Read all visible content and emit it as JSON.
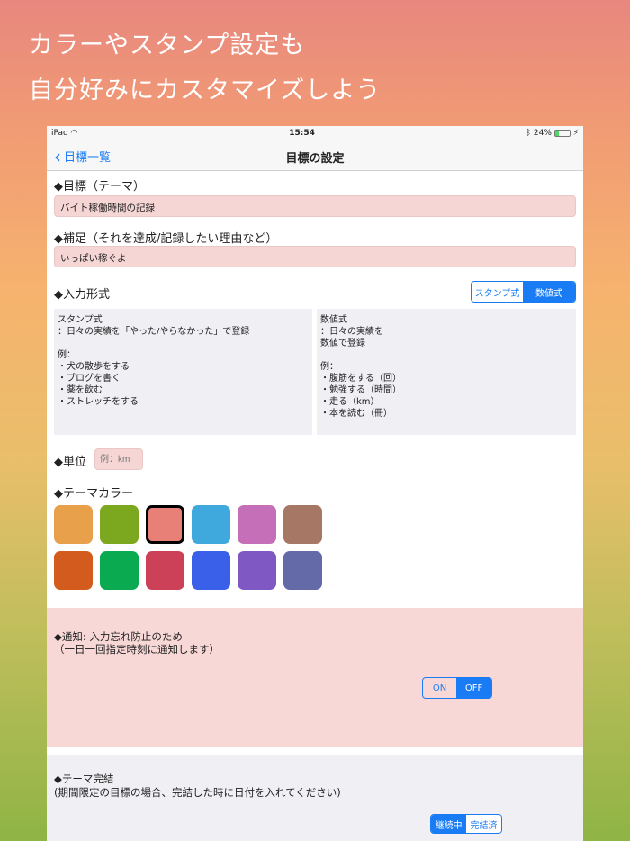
{
  "promo": {
    "line1": "カラーやスタンプ設定も",
    "line2": "自分好みにカスタマイズしよう"
  },
  "status": {
    "device": "iPad",
    "time": "15:54",
    "battery": "24%"
  },
  "nav": {
    "back": "目標一覧",
    "title": "目標の設定"
  },
  "goal": {
    "label": "◆目標（テーマ）",
    "value": "バイト稼働時間の記録"
  },
  "note": {
    "label": "◆補足（それを達成/記録したい理由など）",
    "value": "いっぱい稼ぐよ"
  },
  "input_type": {
    "label": "◆入力形式",
    "options": [
      "スタンプ式",
      "数値式"
    ],
    "selected": "数値式",
    "stamp_desc": "スタンプ式\n：日々の実績を「やった/やらなかった」で登録\n\n例：\n・犬の散歩をする\n・ブログを書く\n・薬を飲む\n・ストレッチをする",
    "number_desc": "数値式\n：日々の実績を\n数値で登録\n\n例：\n・腹筋をする（回）\n・勉強する（時間）\n・走る（km）\n・本を読む（冊）"
  },
  "unit": {
    "label": "◆単位",
    "placeholder": "例：km"
  },
  "theme_color": {
    "label": "◆テーマカラー",
    "colors": [
      "#E9A04A",
      "#7BA81E",
      "#E88078",
      "#3FA8DC",
      "#C46FB8",
      "#A57764",
      "#D35B1E",
      "#0AAA50",
      "#CC4058",
      "#3A5FE8",
      "#8058C4",
      "#6469A8"
    ],
    "selected_index": 2
  },
  "notification": {
    "label": "◆通知: 入力忘れ防止のため",
    "sub": "（一日一回指定時刻に通知します）",
    "options": [
      "ON",
      "OFF"
    ],
    "selected": "OFF"
  },
  "completion": {
    "label": "◆テーマ完結",
    "sub": "(期間限定の目標の場合、完結した時に日付を入れてください)",
    "options": [
      "継続中",
      "完結済"
    ],
    "selected": "継続中"
  }
}
